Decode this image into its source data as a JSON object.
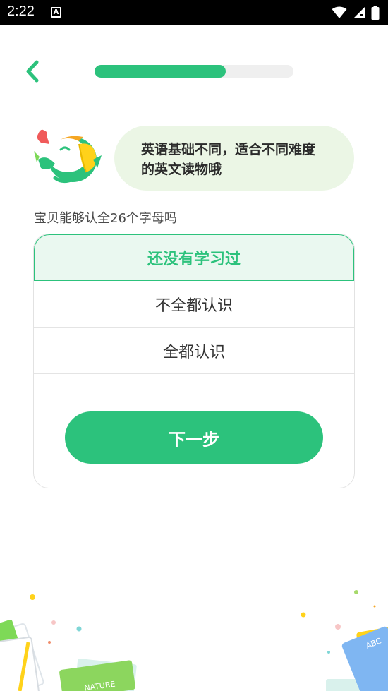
{
  "status_bar": {
    "time": "2:22",
    "notification_letter": "A"
  },
  "progress": {
    "fraction": 0.66
  },
  "bubble": {
    "line1": "英语基础不同，适合不同难度",
    "line2": "的英文读物哦"
  },
  "question": "宝贝能够认全26个字母吗",
  "options": [
    {
      "label": "还没有学习过",
      "selected": true
    },
    {
      "label": "不全都认识",
      "selected": false
    },
    {
      "label": "全都认识",
      "selected": false
    }
  ],
  "next_button": "下一步",
  "decor_labels": {
    "nature_book": "NATURE",
    "abc_book": "ABC"
  },
  "colors": {
    "accent": "#2cc27c",
    "bubble_bg": "#ebf6e5",
    "selected_bg": "#eaf8f0"
  }
}
